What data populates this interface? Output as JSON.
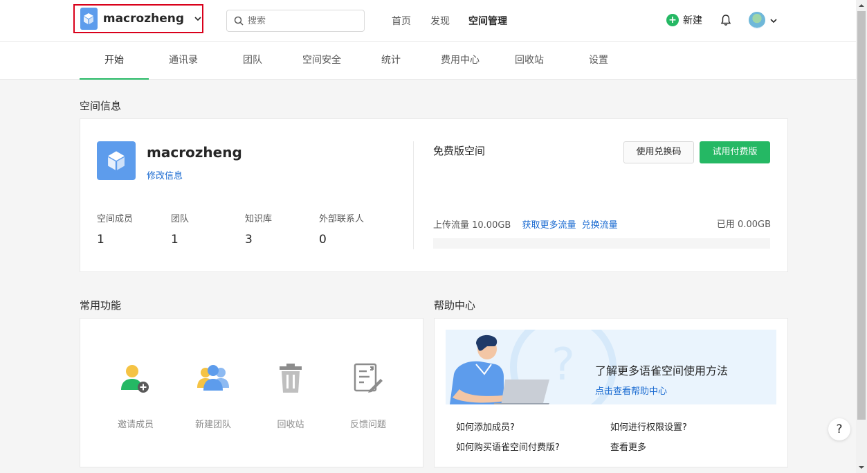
{
  "header": {
    "space_name": "macrozheng",
    "search_placeholder": "搜索",
    "nav": [
      "首页",
      "发现",
      "空间管理"
    ],
    "new_label": "新建"
  },
  "tabs": [
    "开始",
    "通讯录",
    "团队",
    "空间安全",
    "统计",
    "费用中心",
    "回收站",
    "设置"
  ],
  "space_info": {
    "section_title": "空间信息",
    "name": "macrozheng",
    "edit_link": "修改信息",
    "stats": [
      {
        "label": "空间成员",
        "value": "1"
      },
      {
        "label": "团队",
        "value": "1"
      },
      {
        "label": "知识库",
        "value": "3"
      },
      {
        "label": "外部联系人",
        "value": "0"
      }
    ],
    "plan_title": "免费版空间",
    "redeem_button": "使用兑换码",
    "trial_button": "试用付费版",
    "traffic_label": "上传流量 10.00GB",
    "more_traffic_link": "获取更多流量",
    "exchange_traffic_link": "兑换流量",
    "used_label": "已用 0.00GB",
    "used_fraction": 0
  },
  "common": {
    "section_title": "常用功能",
    "items": [
      "邀请成员",
      "新建团队",
      "回收站",
      "反馈问题"
    ]
  },
  "help": {
    "section_title": "帮助中心",
    "banner_title": "了解更多语雀空间使用方法",
    "banner_link": "点击查看帮助中心",
    "faq": [
      "如何添加成员?",
      "如何进行权限设置?",
      "如何购买语雀空间付费版?",
      "查看更多"
    ]
  },
  "help_button": "?",
  "colors": {
    "accent": "#25b864",
    "link": "#1b6bd1",
    "logo": "#5d9cec",
    "highlight_border": "#d9001b"
  }
}
